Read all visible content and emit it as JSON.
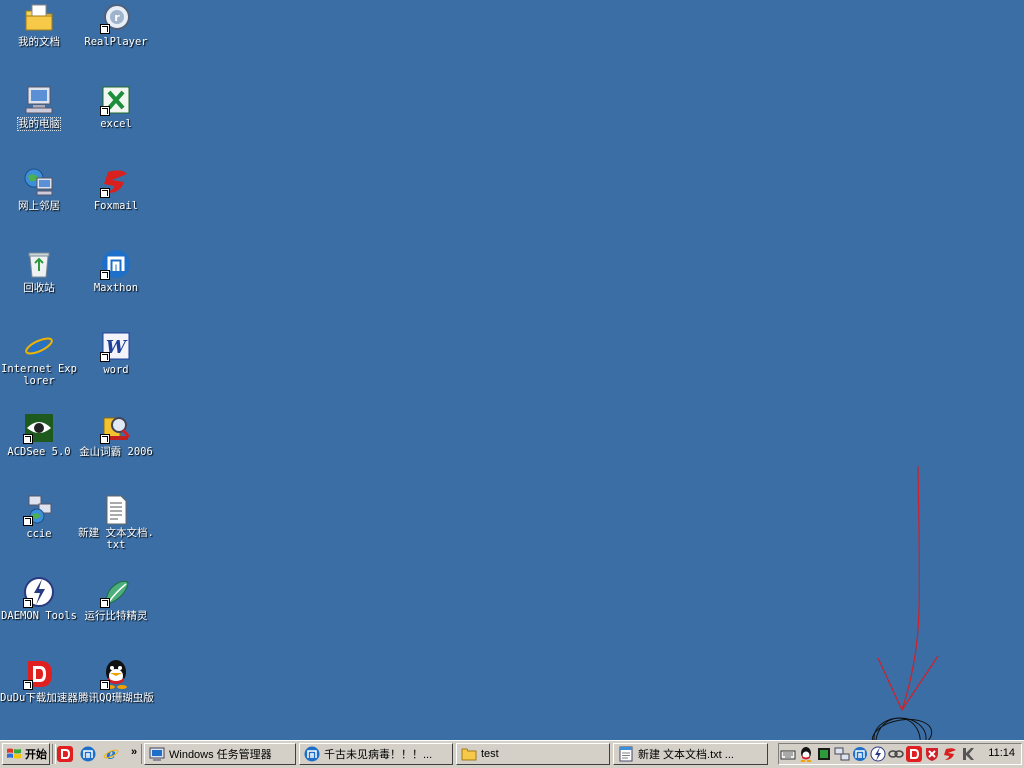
{
  "desktop": {
    "background": "#3a6ea5",
    "icons": [
      {
        "label": "我的文档",
        "icon": "my-documents-icon"
      },
      {
        "label": "RealPlayer",
        "icon": "realplayer-icon"
      },
      {
        "label": "我的电脑",
        "icon": "my-computer-icon"
      },
      {
        "label": "excel",
        "icon": "excel-icon"
      },
      {
        "label": "网上邻居",
        "icon": "network-places-icon"
      },
      {
        "label": "Foxmail",
        "icon": "foxmail-icon"
      },
      {
        "label": "回收站",
        "icon": "recycle-bin-icon"
      },
      {
        "label": "Maxthon",
        "icon": "maxthon-icon"
      },
      {
        "label": "Internet Explorer",
        "icon": "internet-explorer-icon"
      },
      {
        "label": "word",
        "icon": "word-icon"
      },
      {
        "label": "ACDSee 5.0",
        "icon": "acdsee-icon"
      },
      {
        "label": "金山词霸 2006",
        "icon": "kingsoft-dictionary-icon"
      },
      {
        "label": "ccie",
        "icon": "ccie-icon"
      },
      {
        "label": "新建 文本文档.txt",
        "icon": "text-document-icon"
      },
      {
        "label": "DAEMON Tools",
        "icon": "daemon-tools-icon"
      },
      {
        "label": "运行比特精灵",
        "icon": "bitspirit-icon"
      },
      {
        "label": "DuDu下载加速器",
        "icon": "dudu-downloader-icon"
      },
      {
        "label": "腾讯QQ珊瑚虫版",
        "icon": "qq-icon"
      }
    ]
  },
  "taskbar": {
    "start_label": "开始",
    "quicklaunch": [
      "dudu-icon",
      "maxthon-icon",
      "internet-explorer-icon"
    ],
    "chevron": "»",
    "tasks": [
      {
        "label": "Windows 任务管理器",
        "icon": "task-manager-icon"
      },
      {
        "label": "千古未见病毒！！！...",
        "icon": "maxthon-icon"
      },
      {
        "label": "test",
        "icon": "folder-icon"
      },
      {
        "label": "新建 文本文档.txt ...",
        "icon": "notepad-icon"
      }
    ],
    "tray_icons": [
      "keyboard-icon",
      "qq-icon",
      "monitor-icon",
      "network-icon",
      "maxthon-icon",
      "daemon-icon",
      "chain-icon",
      "dudu-icon",
      "shield-icon",
      "foxmail-icon",
      "kingsoft-icon"
    ],
    "clock": "11:14"
  },
  "annotation": {
    "color": "#d0202a"
  }
}
